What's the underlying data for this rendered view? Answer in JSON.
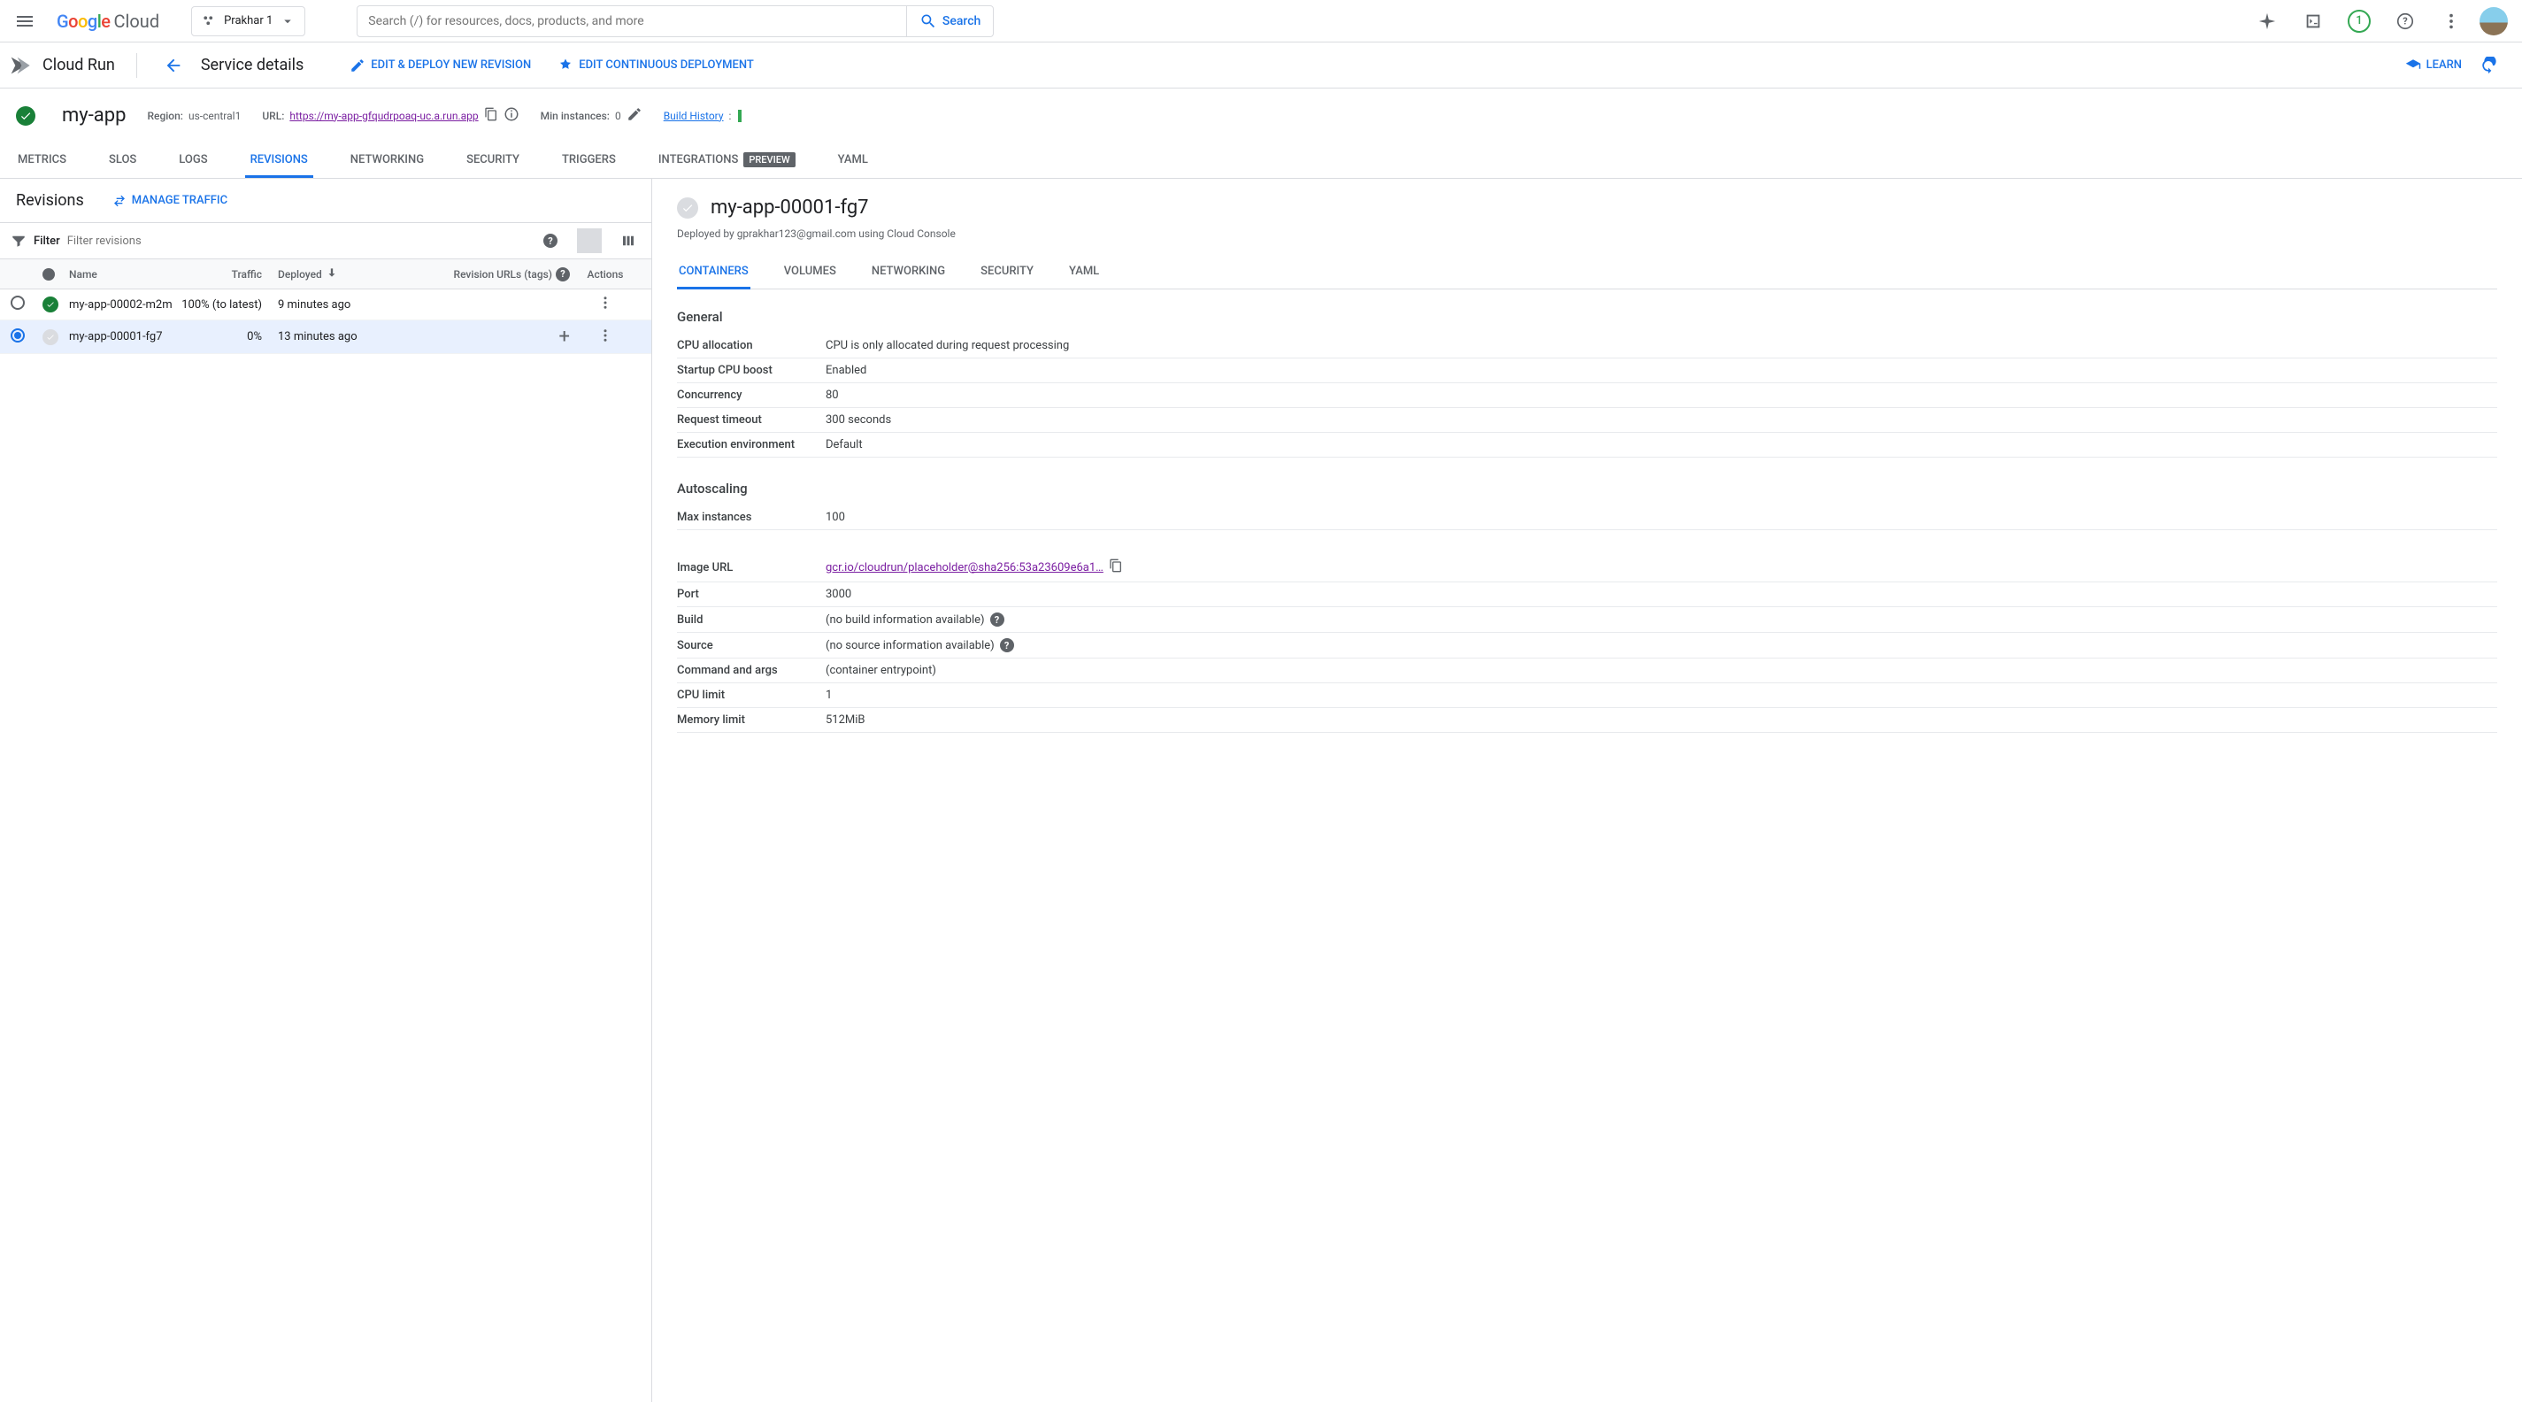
{
  "navbar": {
    "project_name": "Prakhar 1",
    "search_placeholder": "Search (/) for resources, docs, products, and more",
    "search_btn": "Search",
    "notification_count": "1",
    "cloud_text": "Cloud"
  },
  "servicebar": {
    "product": "Cloud Run",
    "page_title": "Service details",
    "edit_deploy": "EDIT & DEPLOY NEW REVISION",
    "edit_cd": "EDIT CONTINUOUS DEPLOYMENT",
    "learn": "LEARN"
  },
  "appmeta": {
    "app_name": "my-app",
    "region_label": "Region:",
    "region_value": "us-central1",
    "url_label": "URL:",
    "url_value": "https://my-app-gfqudrpoaq-uc.a.run.app",
    "min_instances_label": "Min instances:",
    "min_instances_value": "0",
    "build_history": "Build History",
    "build_colon": ":"
  },
  "maintabs": [
    "METRICS",
    "SLOS",
    "LOGS",
    "REVISIONS",
    "NETWORKING",
    "SECURITY",
    "TRIGGERS",
    "INTEGRATIONS",
    "YAML"
  ],
  "maintabs_preview_idx": 7,
  "maintabs_active": "REVISIONS",
  "preview_label": "PREVIEW",
  "left": {
    "title": "Revisions",
    "manage_traffic": "MANAGE TRAFFIC",
    "filter_label": "Filter",
    "filter_placeholder": "Filter revisions",
    "columns": {
      "name": "Name",
      "traffic": "Traffic",
      "deployed": "Deployed",
      "urls": "Revision URLs (tags)",
      "actions": "Actions"
    },
    "rows": [
      {
        "selected": false,
        "status": "green",
        "name": "my-app-00002-m2m",
        "traffic": "100% (to latest)",
        "deployed": "9 minutes ago",
        "has_plus": false
      },
      {
        "selected": true,
        "status": "gray",
        "name": "my-app-00001-fg7",
        "traffic": "0%",
        "deployed": "13 minutes ago",
        "has_plus": true
      }
    ]
  },
  "right": {
    "title": "my-app-00001-fg7",
    "deployed_by": "Deployed by gprakhar123@gmail.com using Cloud Console",
    "subtabs": [
      "CONTAINERS",
      "VOLUMES",
      "NETWORKING",
      "SECURITY",
      "YAML"
    ],
    "subtabs_active": "CONTAINERS",
    "sections": {
      "general": {
        "title": "General",
        "rows": [
          {
            "k": "CPU allocation",
            "v": "CPU is only allocated during request processing"
          },
          {
            "k": "Startup CPU boost",
            "v": "Enabled"
          },
          {
            "k": "Concurrency",
            "v": "80"
          },
          {
            "k": "Request timeout",
            "v": "300 seconds"
          },
          {
            "k": "Execution environment",
            "v": "Default"
          }
        ]
      },
      "autoscaling": {
        "title": "Autoscaling",
        "rows": [
          {
            "k": "Max instances",
            "v": "100"
          }
        ]
      },
      "image": {
        "rows": [
          {
            "k": "Image URL",
            "v_link": "gcr.io/cloudrun/placeholder@sha256:53a23609e6a1…",
            "copy": true
          },
          {
            "k": "Port",
            "v": "3000"
          },
          {
            "k": "Build",
            "v": "(no build information available)",
            "help": true
          },
          {
            "k": "Source",
            "v": "(no source information available)",
            "help": true
          },
          {
            "k": "Command and args",
            "v": "(container entrypoint)"
          },
          {
            "k": "CPU limit",
            "v": "1"
          },
          {
            "k": "Memory limit",
            "v": "512MiB"
          }
        ]
      }
    }
  }
}
